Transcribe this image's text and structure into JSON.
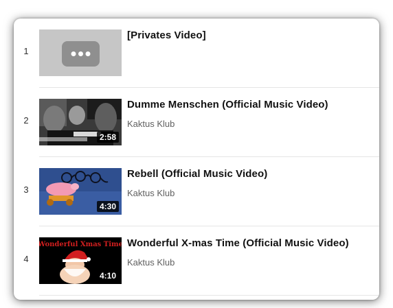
{
  "playlist": {
    "items": [
      {
        "index": "1",
        "title": "[Privates Video]",
        "channel": "",
        "duration": ""
      },
      {
        "index": "2",
        "title": "Dumme Menschen (Official Music Video)",
        "channel": "Kaktus Klub",
        "duration": "2:58"
      },
      {
        "index": "3",
        "title": "Rebell (Official Music Video)",
        "channel": "Kaktus Klub",
        "duration": "4:30"
      },
      {
        "index": "4",
        "title": "Wonderful X-mas Time (Official Music Video)",
        "channel": "Kaktus Klub",
        "duration": "4:10"
      }
    ],
    "thumbnail_text": {
      "item4_logo": "Wonderful Xmas Time"
    }
  },
  "icons": {
    "private_placeholder": "more-horiz-icon"
  },
  "colors": {
    "title": "#111111",
    "channel": "#606060",
    "duration_bg": "#000000",
    "private_thumb_bg": "#c6c6c6",
    "xmas_logo_red": "#d21f1f"
  }
}
